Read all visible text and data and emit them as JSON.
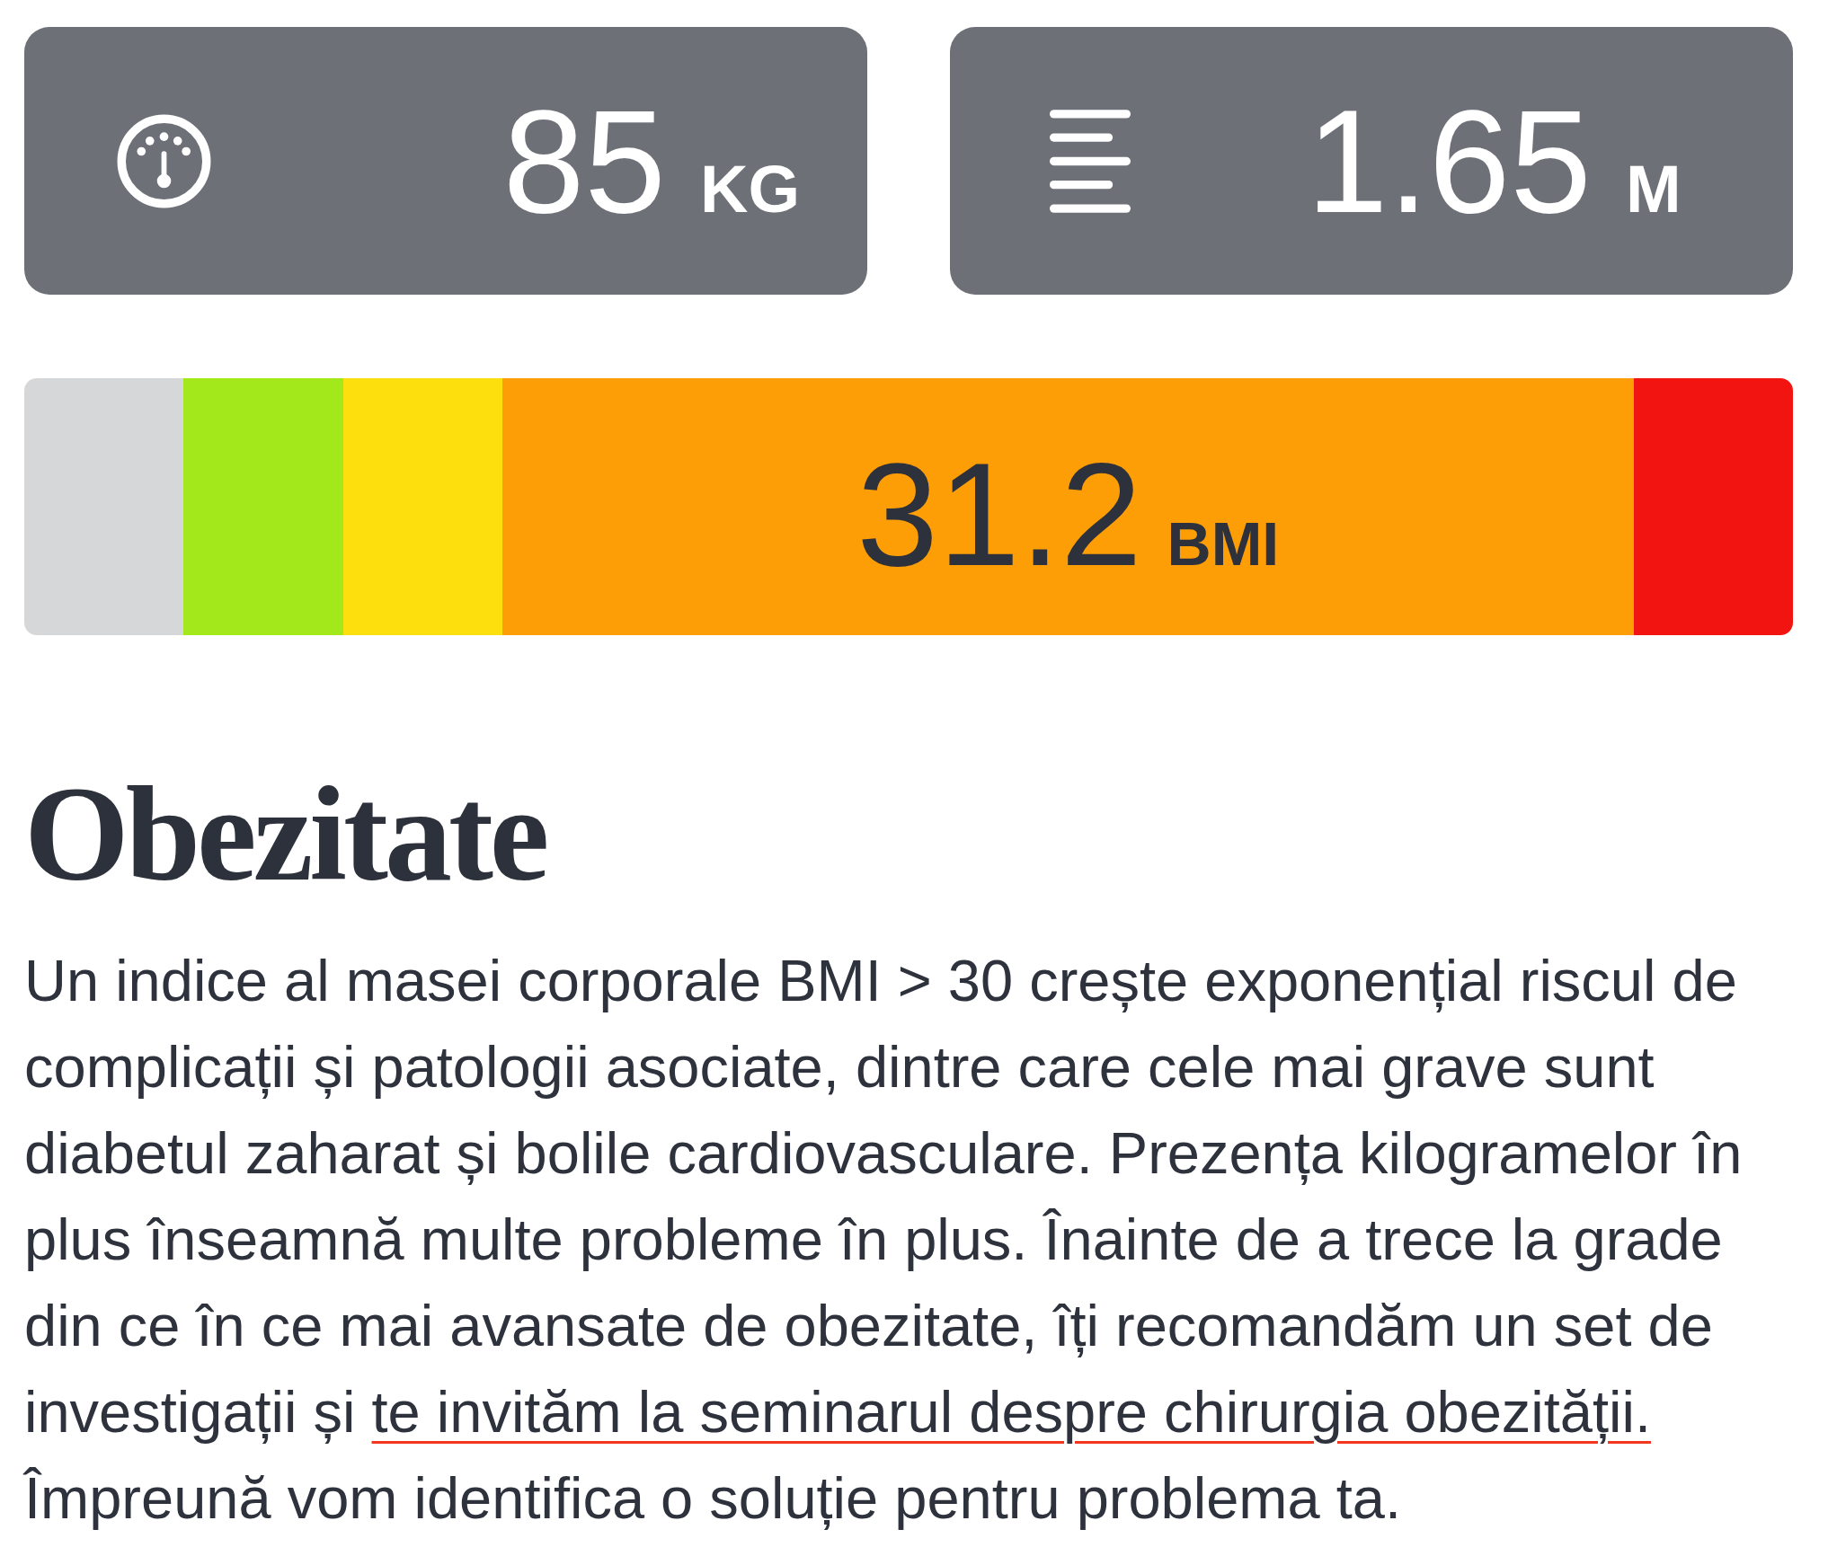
{
  "measurements": [
    {
      "kind": "weight",
      "value": "85",
      "unit": "KG"
    },
    {
      "kind": "height",
      "value": "1.65",
      "unit": "M"
    }
  ],
  "bmi_scale": {
    "segments": [
      {
        "color": "#d6d7d9",
        "selected": false
      },
      {
        "color": "#a2e81b",
        "selected": false
      },
      {
        "color": "#fddf0e",
        "selected": false
      },
      {
        "color": "#fe9e07",
        "selected": true
      },
      {
        "color": "#f21410",
        "selected": false
      }
    ],
    "reading": {
      "value": "31.2",
      "unit": "BMI"
    }
  },
  "result": {
    "title": "Obezitate",
    "text_before": "Un indice al masei corporale BMI > 30 crește exponențial riscul de complicații și patologii asociate, dintre care cele mai grave sunt diabetul zaharat și bolile cardiovasculare. Prezența kilogramelor în plus înseamnă multe probleme în plus. Înainte de a trece la grade din ce în ce mai avansate de obezitate, îți recomandăm un set de investigații și ",
    "link": "te invităm la seminarul despre chirurgia obezității.",
    "text_after": " Împreună vom identifica o soluție pentru problema ta."
  }
}
